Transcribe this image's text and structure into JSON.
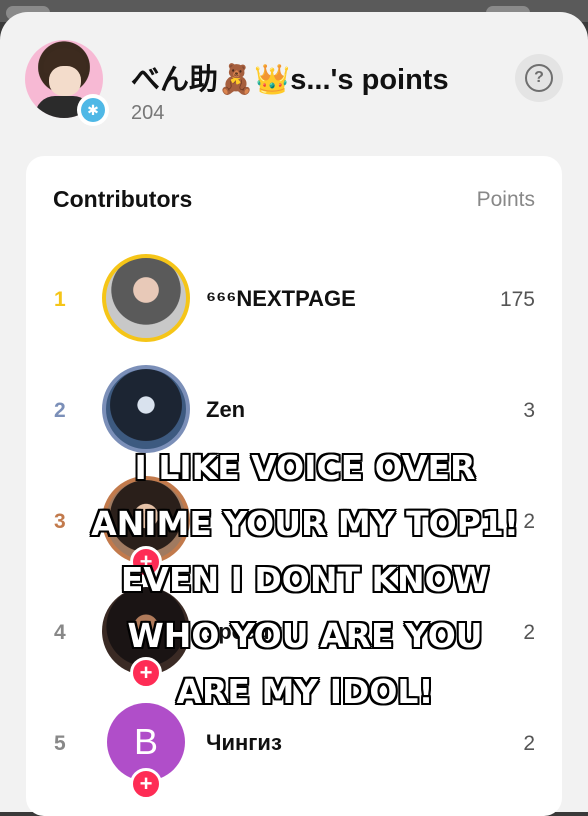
{
  "header": {
    "title": "べん助🧸👑s...'s points",
    "total_points": "204"
  },
  "contributors": {
    "heading": "Contributors",
    "points_heading": "Points",
    "rows": [
      {
        "rank": "1",
        "name": "⁶⁶⁶NEXTPAGE",
        "points": "175",
        "rank_color": "#f5c518"
      },
      {
        "rank": "2",
        "name": "Zen",
        "points": "3",
        "rank_color": "#7b8fb8"
      },
      {
        "rank": "3",
        "name": "",
        "points": "2",
        "rank_color": "#c27a4c"
      },
      {
        "rank": "4",
        "name": "speedy",
        "points": "2",
        "rank_color": "#888888"
      },
      {
        "rank": "5",
        "name": "Чингиз",
        "points": "2",
        "rank_color": "#888888",
        "avatar_letter": "B"
      }
    ]
  },
  "overlay": {
    "lines": [
      "I LIKE VOICE OVER",
      "ANIME YOUR MY TOP1!",
      "EVEN I DONT KNOW",
      "WHO YOU ARE YOU",
      "ARE MY IDOL!"
    ]
  }
}
